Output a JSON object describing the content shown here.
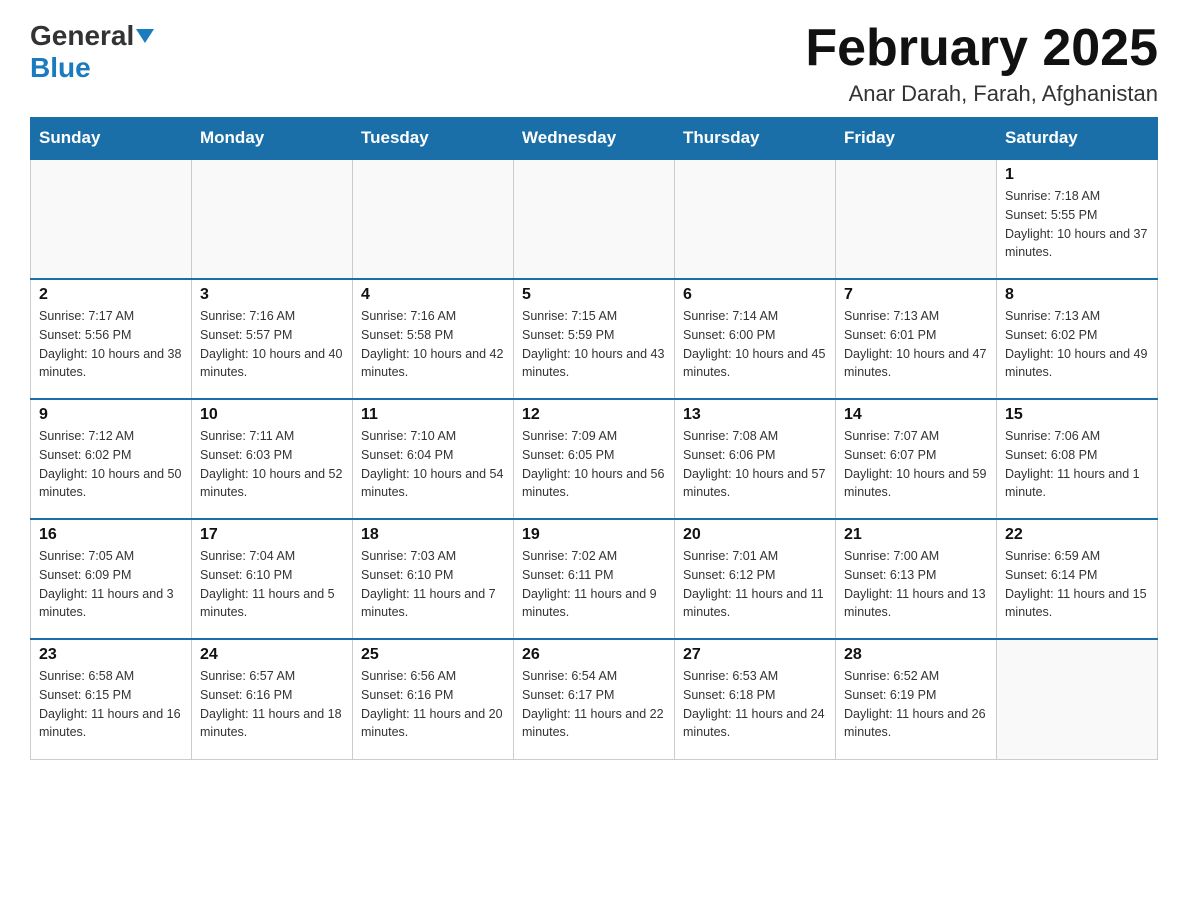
{
  "header": {
    "logo_general": "General",
    "logo_blue": "Blue",
    "title": "February 2025",
    "subtitle": "Anar Darah, Farah, Afghanistan"
  },
  "days_of_week": [
    "Sunday",
    "Monday",
    "Tuesday",
    "Wednesday",
    "Thursday",
    "Friday",
    "Saturday"
  ],
  "weeks": [
    {
      "days": [
        {
          "number": "",
          "info": ""
        },
        {
          "number": "",
          "info": ""
        },
        {
          "number": "",
          "info": ""
        },
        {
          "number": "",
          "info": ""
        },
        {
          "number": "",
          "info": ""
        },
        {
          "number": "",
          "info": ""
        },
        {
          "number": "1",
          "info": "Sunrise: 7:18 AM\nSunset: 5:55 PM\nDaylight: 10 hours and 37 minutes."
        }
      ]
    },
    {
      "days": [
        {
          "number": "2",
          "info": "Sunrise: 7:17 AM\nSunset: 5:56 PM\nDaylight: 10 hours and 38 minutes."
        },
        {
          "number": "3",
          "info": "Sunrise: 7:16 AM\nSunset: 5:57 PM\nDaylight: 10 hours and 40 minutes."
        },
        {
          "number": "4",
          "info": "Sunrise: 7:16 AM\nSunset: 5:58 PM\nDaylight: 10 hours and 42 minutes."
        },
        {
          "number": "5",
          "info": "Sunrise: 7:15 AM\nSunset: 5:59 PM\nDaylight: 10 hours and 43 minutes."
        },
        {
          "number": "6",
          "info": "Sunrise: 7:14 AM\nSunset: 6:00 PM\nDaylight: 10 hours and 45 minutes."
        },
        {
          "number": "7",
          "info": "Sunrise: 7:13 AM\nSunset: 6:01 PM\nDaylight: 10 hours and 47 minutes."
        },
        {
          "number": "8",
          "info": "Sunrise: 7:13 AM\nSunset: 6:02 PM\nDaylight: 10 hours and 49 minutes."
        }
      ]
    },
    {
      "days": [
        {
          "number": "9",
          "info": "Sunrise: 7:12 AM\nSunset: 6:02 PM\nDaylight: 10 hours and 50 minutes."
        },
        {
          "number": "10",
          "info": "Sunrise: 7:11 AM\nSunset: 6:03 PM\nDaylight: 10 hours and 52 minutes."
        },
        {
          "number": "11",
          "info": "Sunrise: 7:10 AM\nSunset: 6:04 PM\nDaylight: 10 hours and 54 minutes."
        },
        {
          "number": "12",
          "info": "Sunrise: 7:09 AM\nSunset: 6:05 PM\nDaylight: 10 hours and 56 minutes."
        },
        {
          "number": "13",
          "info": "Sunrise: 7:08 AM\nSunset: 6:06 PM\nDaylight: 10 hours and 57 minutes."
        },
        {
          "number": "14",
          "info": "Sunrise: 7:07 AM\nSunset: 6:07 PM\nDaylight: 10 hours and 59 minutes."
        },
        {
          "number": "15",
          "info": "Sunrise: 7:06 AM\nSunset: 6:08 PM\nDaylight: 11 hours and 1 minute."
        }
      ]
    },
    {
      "days": [
        {
          "number": "16",
          "info": "Sunrise: 7:05 AM\nSunset: 6:09 PM\nDaylight: 11 hours and 3 minutes."
        },
        {
          "number": "17",
          "info": "Sunrise: 7:04 AM\nSunset: 6:10 PM\nDaylight: 11 hours and 5 minutes."
        },
        {
          "number": "18",
          "info": "Sunrise: 7:03 AM\nSunset: 6:10 PM\nDaylight: 11 hours and 7 minutes."
        },
        {
          "number": "19",
          "info": "Sunrise: 7:02 AM\nSunset: 6:11 PM\nDaylight: 11 hours and 9 minutes."
        },
        {
          "number": "20",
          "info": "Sunrise: 7:01 AM\nSunset: 6:12 PM\nDaylight: 11 hours and 11 minutes."
        },
        {
          "number": "21",
          "info": "Sunrise: 7:00 AM\nSunset: 6:13 PM\nDaylight: 11 hours and 13 minutes."
        },
        {
          "number": "22",
          "info": "Sunrise: 6:59 AM\nSunset: 6:14 PM\nDaylight: 11 hours and 15 minutes."
        }
      ]
    },
    {
      "days": [
        {
          "number": "23",
          "info": "Sunrise: 6:58 AM\nSunset: 6:15 PM\nDaylight: 11 hours and 16 minutes."
        },
        {
          "number": "24",
          "info": "Sunrise: 6:57 AM\nSunset: 6:16 PM\nDaylight: 11 hours and 18 minutes."
        },
        {
          "number": "25",
          "info": "Sunrise: 6:56 AM\nSunset: 6:16 PM\nDaylight: 11 hours and 20 minutes."
        },
        {
          "number": "26",
          "info": "Sunrise: 6:54 AM\nSunset: 6:17 PM\nDaylight: 11 hours and 22 minutes."
        },
        {
          "number": "27",
          "info": "Sunrise: 6:53 AM\nSunset: 6:18 PM\nDaylight: 11 hours and 24 minutes."
        },
        {
          "number": "28",
          "info": "Sunrise: 6:52 AM\nSunset: 6:19 PM\nDaylight: 11 hours and 26 minutes."
        },
        {
          "number": "",
          "info": ""
        }
      ]
    }
  ]
}
